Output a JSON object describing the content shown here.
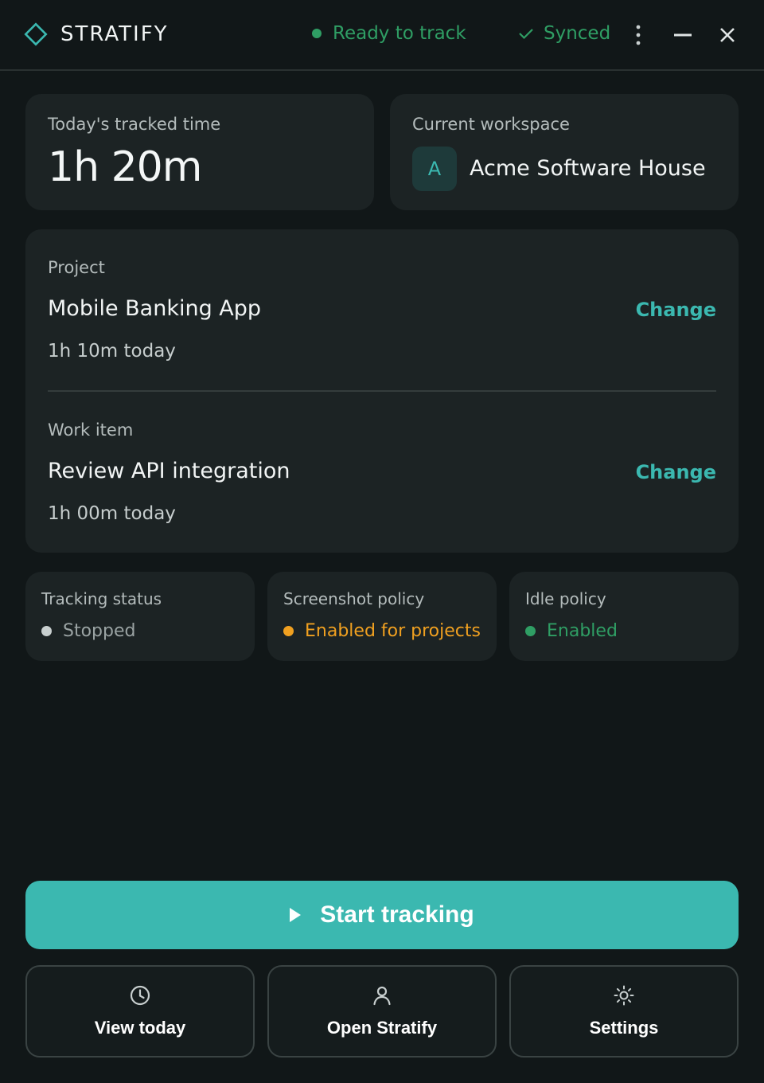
{
  "app": {
    "name": "STRATIFY"
  },
  "header": {
    "status_text": "Ready to track",
    "sync_text": "Synced",
    "colors": {
      "status": "#2f9e64",
      "accent": "#3bb8b0"
    }
  },
  "tracked": {
    "label": "Today's tracked time",
    "value": "1h 20m"
  },
  "workspace": {
    "label": "Current workspace",
    "initial": "A",
    "name": "Acme Software House"
  },
  "project": {
    "label": "Project",
    "name": "Mobile Banking App",
    "time": "1h 10m today",
    "change_label": "Change"
  },
  "work_item": {
    "label": "Work item",
    "name": "Review API integration",
    "time": "1h 00m today",
    "change_label": "Change"
  },
  "stats": [
    {
      "label": "Tracking status",
      "value": "Stopped",
      "color": "#9aa3a3"
    },
    {
      "label": "Screenshot policy",
      "value": "Enabled for projects",
      "color": "#f0a020"
    },
    {
      "label": "Idle policy",
      "value": "Enabled",
      "color": "#2f9e64"
    }
  ],
  "start_button": {
    "label": "Start tracking",
    "icon": "play-icon"
  },
  "actions": [
    {
      "label": "View today",
      "icon": "clock-icon"
    },
    {
      "label": "Open Stratify",
      "icon": "user-icon"
    },
    {
      "label": "Settings",
      "icon": "sun-gear-icon"
    }
  ]
}
